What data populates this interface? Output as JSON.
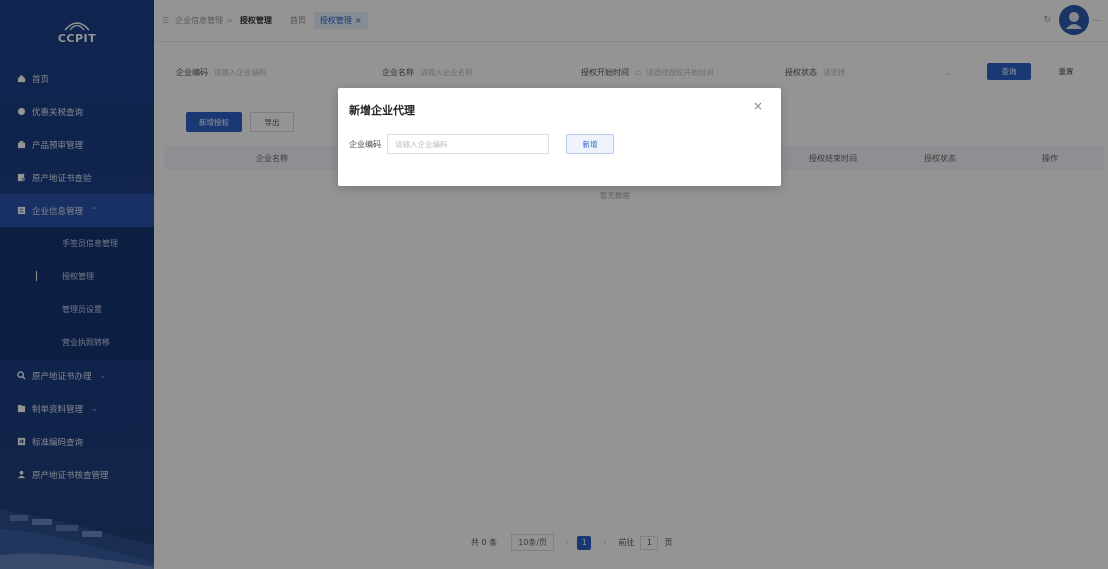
{
  "logo": {
    "text": "CCPIT"
  },
  "sidebar": {
    "items": [
      {
        "label": "首页",
        "icon": "home-icon"
      },
      {
        "label": "优惠关税查询",
        "icon": "discount-icon"
      },
      {
        "label": "产品预审管理",
        "icon": "product-icon"
      },
      {
        "label": "原产地证书查验",
        "icon": "certificate-check-icon"
      },
      {
        "label": "企业信息管理",
        "icon": "company-icon",
        "expanded": true
      }
    ],
    "subitems": [
      {
        "label": "手签员信息管理"
      },
      {
        "label": "授权管理",
        "current": true
      },
      {
        "label": "管理员设置"
      },
      {
        "label": "营业执照转移"
      }
    ],
    "items2": [
      {
        "label": "原产地证书办理",
        "icon": "certificate-icon"
      },
      {
        "label": "制单资料管理",
        "icon": "document-icon"
      },
      {
        "label": "标准编码查询",
        "icon": "barcode-icon"
      },
      {
        "label": "原产地证书核查管理",
        "icon": "user-check-icon"
      }
    ]
  },
  "breadcrumb": {
    "parent": "企业信息管理",
    "sep": ">",
    "current": "授权管理"
  },
  "tabs": {
    "home": "首页",
    "active": "授权管理",
    "close": "×"
  },
  "user": {
    "refresh": "↻",
    "name": "—"
  },
  "search": {
    "code_label": "企业编码",
    "code_placeholder": "请输入企业编码",
    "name_label": "企业名称",
    "name_placeholder": "请输入企业名称",
    "start_label": "授权开始时间",
    "start_placeholder": "请选择授权开始时间",
    "status_label": "授权状态",
    "status_placeholder": "请选择",
    "query": "查询",
    "reset": "重置"
  },
  "actions": {
    "add": "新增授权",
    "export": "导出"
  },
  "table": {
    "headers": [
      "企业名称",
      "授权结束时间",
      "授权状态",
      "操作"
    ],
    "empty": "暂无数据"
  },
  "pager": {
    "total": "共 0 条",
    "size": "10条/页",
    "prev": "‹",
    "page": "1",
    "next": "›",
    "goto": "前往",
    "page_input": "1",
    "unit": "页"
  },
  "dialog": {
    "title": "新增企业代理",
    "close": "×",
    "label": "企业编码",
    "placeholder": "请输入企业编码",
    "button": "新增"
  },
  "colors": {
    "primary": "#2d63c8",
    "sidebar": "#1c3d82"
  }
}
